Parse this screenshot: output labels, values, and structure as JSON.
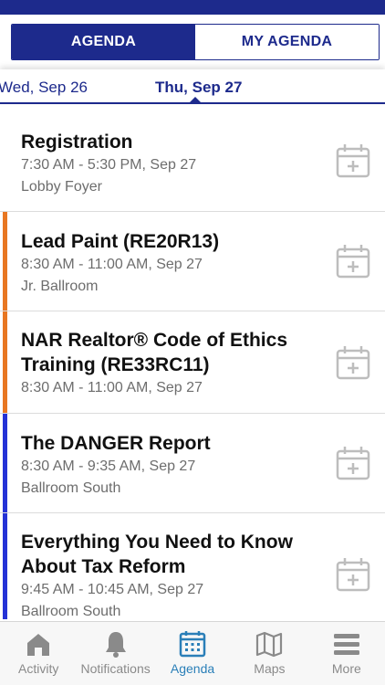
{
  "colors": {
    "brand": "#1d2a8c",
    "track_orange": "#e87722",
    "track_blue": "#2432d6",
    "active_tab": "#2a7fb8",
    "muted": "#8a8a8a"
  },
  "segment": {
    "agenda_label": "AGENDA",
    "my_agenda_label": "MY AGENDA",
    "selected": "AGENDA"
  },
  "dates": {
    "previous": "Wed, Sep 26",
    "current": "Thu, Sep 27"
  },
  "sessions": [
    {
      "title": "Registration",
      "time": "7:30 AM - 5:30 PM, Sep 27",
      "room": "Lobby Foyer",
      "track_color": "",
      "icon": "calendar-add-icon"
    },
    {
      "title": "Lead Paint (RE20R13)",
      "time": "8:30 AM - 11:00 AM, Sep 27",
      "room": "Jr. Ballroom",
      "track_color": "#e87722",
      "icon": "calendar-add-icon"
    },
    {
      "title": "NAR Realtor® Code of Ethics Training (RE33RC11)",
      "time": "8:30 AM - 11:00 AM, Sep 27",
      "room": "",
      "track_color": "#e87722",
      "icon": "calendar-add-icon"
    },
    {
      "title": "The DANGER Report",
      "time": "8:30 AM - 9:35 AM, Sep 27",
      "room": "Ballroom South",
      "track_color": "#2432d6",
      "icon": "calendar-add-icon"
    },
    {
      "title": "Everything You Need to Know About Tax Reform",
      "time": "9:45 AM - 10:45 AM, Sep 27",
      "room": "Ballroom South",
      "track_color": "#2432d6",
      "icon": "calendar-add-icon"
    }
  ],
  "tabs": [
    {
      "label": "Activity",
      "icon": "home-icon"
    },
    {
      "label": "Notifications",
      "icon": "bell-icon"
    },
    {
      "label": "Agenda",
      "icon": "calendar-icon",
      "active": true
    },
    {
      "label": "Maps",
      "icon": "map-icon"
    },
    {
      "label": "More",
      "icon": "menu-icon"
    }
  ]
}
